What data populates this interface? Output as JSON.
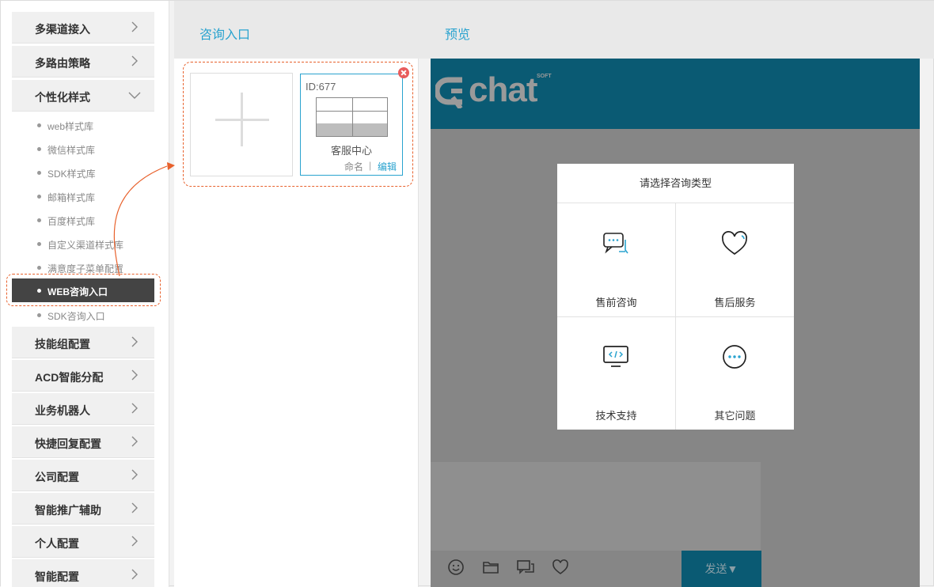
{
  "sidebar": {
    "groups_top": [
      {
        "label": "多渠道接入"
      },
      {
        "label": "多路由策略"
      },
      {
        "label": "个性化样式"
      }
    ],
    "sub_items": [
      {
        "label": "web样式库"
      },
      {
        "label": "微信样式库"
      },
      {
        "label": "SDK样式库"
      },
      {
        "label": "邮箱样式库"
      },
      {
        "label": "百度样式库"
      },
      {
        "label": "自定义渠道样式库"
      },
      {
        "label": "满意度子菜单配置"
      },
      {
        "label": "WEB咨询入口",
        "active": true
      },
      {
        "label": "SDK咨询入口"
      }
    ],
    "groups_bottom": [
      {
        "label": "技能组配置"
      },
      {
        "label": "ACD智能分配"
      },
      {
        "label": "业务机器人"
      },
      {
        "label": "快捷回复配置"
      },
      {
        "label": "公司配置"
      },
      {
        "label": "智能推广辅助"
      },
      {
        "label": "个人配置"
      },
      {
        "label": "智能配置"
      }
    ]
  },
  "tabs": {
    "entry": "咨询入口",
    "preview": "预览"
  },
  "template_card": {
    "id_text": "ID:677",
    "title": "客服中心",
    "rename": "命名",
    "separator": "|",
    "edit": "编辑"
  },
  "preview": {
    "logo_text": "chat",
    "logo_soft": "SOFT",
    "dialog_title": "请选择咨询类型",
    "options": [
      {
        "label": "售前咨询",
        "icon": "chat-bubbles-icon"
      },
      {
        "label": "售后服务",
        "icon": "heart-icon"
      },
      {
        "label": "技术支持",
        "icon": "monitor-code-icon"
      },
      {
        "label": "其它问题",
        "icon": "ellipsis-circle-icon"
      }
    ],
    "send_label": "发送▼"
  },
  "colors": {
    "accent": "#2aa3cf",
    "highlight": "#e8612c",
    "header_teal": "#0a5a73",
    "active_item": "#444444"
  }
}
